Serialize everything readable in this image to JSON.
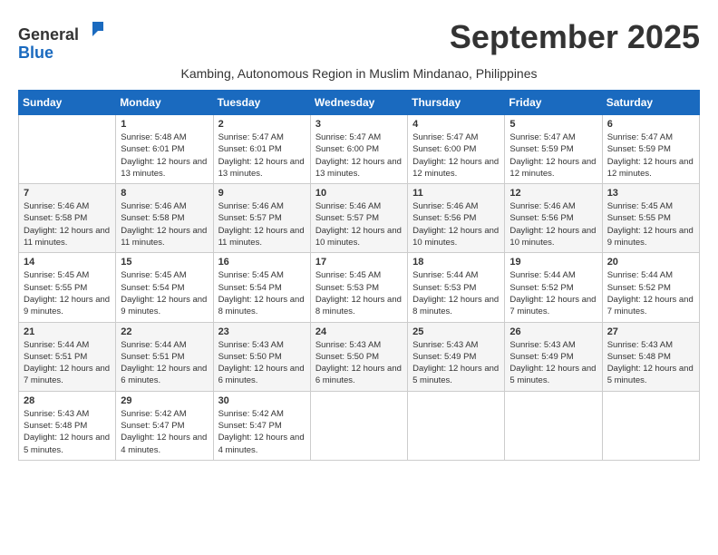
{
  "header": {
    "logo_general": "General",
    "logo_blue": "Blue",
    "month_year": "September 2025",
    "subtitle": "Kambing, Autonomous Region in Muslim Mindanao, Philippines"
  },
  "days_of_week": [
    "Sunday",
    "Monday",
    "Tuesday",
    "Wednesday",
    "Thursday",
    "Friday",
    "Saturday"
  ],
  "weeks": [
    [
      {
        "day": "",
        "sunrise": "",
        "sunset": "",
        "daylight": ""
      },
      {
        "day": "1",
        "sunrise": "Sunrise: 5:48 AM",
        "sunset": "Sunset: 6:01 PM",
        "daylight": "Daylight: 12 hours and 13 minutes."
      },
      {
        "day": "2",
        "sunrise": "Sunrise: 5:47 AM",
        "sunset": "Sunset: 6:01 PM",
        "daylight": "Daylight: 12 hours and 13 minutes."
      },
      {
        "day": "3",
        "sunrise": "Sunrise: 5:47 AM",
        "sunset": "Sunset: 6:00 PM",
        "daylight": "Daylight: 12 hours and 13 minutes."
      },
      {
        "day": "4",
        "sunrise": "Sunrise: 5:47 AM",
        "sunset": "Sunset: 6:00 PM",
        "daylight": "Daylight: 12 hours and 12 minutes."
      },
      {
        "day": "5",
        "sunrise": "Sunrise: 5:47 AM",
        "sunset": "Sunset: 5:59 PM",
        "daylight": "Daylight: 12 hours and 12 minutes."
      },
      {
        "day": "6",
        "sunrise": "Sunrise: 5:47 AM",
        "sunset": "Sunset: 5:59 PM",
        "daylight": "Daylight: 12 hours and 12 minutes."
      }
    ],
    [
      {
        "day": "7",
        "sunrise": "Sunrise: 5:46 AM",
        "sunset": "Sunset: 5:58 PM",
        "daylight": "Daylight: 12 hours and 11 minutes."
      },
      {
        "day": "8",
        "sunrise": "Sunrise: 5:46 AM",
        "sunset": "Sunset: 5:58 PM",
        "daylight": "Daylight: 12 hours and 11 minutes."
      },
      {
        "day": "9",
        "sunrise": "Sunrise: 5:46 AM",
        "sunset": "Sunset: 5:57 PM",
        "daylight": "Daylight: 12 hours and 11 minutes."
      },
      {
        "day": "10",
        "sunrise": "Sunrise: 5:46 AM",
        "sunset": "Sunset: 5:57 PM",
        "daylight": "Daylight: 12 hours and 10 minutes."
      },
      {
        "day": "11",
        "sunrise": "Sunrise: 5:46 AM",
        "sunset": "Sunset: 5:56 PM",
        "daylight": "Daylight: 12 hours and 10 minutes."
      },
      {
        "day": "12",
        "sunrise": "Sunrise: 5:46 AM",
        "sunset": "Sunset: 5:56 PM",
        "daylight": "Daylight: 12 hours and 10 minutes."
      },
      {
        "day": "13",
        "sunrise": "Sunrise: 5:45 AM",
        "sunset": "Sunset: 5:55 PM",
        "daylight": "Daylight: 12 hours and 9 minutes."
      }
    ],
    [
      {
        "day": "14",
        "sunrise": "Sunrise: 5:45 AM",
        "sunset": "Sunset: 5:55 PM",
        "daylight": "Daylight: 12 hours and 9 minutes."
      },
      {
        "day": "15",
        "sunrise": "Sunrise: 5:45 AM",
        "sunset": "Sunset: 5:54 PM",
        "daylight": "Daylight: 12 hours and 9 minutes."
      },
      {
        "day": "16",
        "sunrise": "Sunrise: 5:45 AM",
        "sunset": "Sunset: 5:54 PM",
        "daylight": "Daylight: 12 hours and 8 minutes."
      },
      {
        "day": "17",
        "sunrise": "Sunrise: 5:45 AM",
        "sunset": "Sunset: 5:53 PM",
        "daylight": "Daylight: 12 hours and 8 minutes."
      },
      {
        "day": "18",
        "sunrise": "Sunrise: 5:44 AM",
        "sunset": "Sunset: 5:53 PM",
        "daylight": "Daylight: 12 hours and 8 minutes."
      },
      {
        "day": "19",
        "sunrise": "Sunrise: 5:44 AM",
        "sunset": "Sunset: 5:52 PM",
        "daylight": "Daylight: 12 hours and 7 minutes."
      },
      {
        "day": "20",
        "sunrise": "Sunrise: 5:44 AM",
        "sunset": "Sunset: 5:52 PM",
        "daylight": "Daylight: 12 hours and 7 minutes."
      }
    ],
    [
      {
        "day": "21",
        "sunrise": "Sunrise: 5:44 AM",
        "sunset": "Sunset: 5:51 PM",
        "daylight": "Daylight: 12 hours and 7 minutes."
      },
      {
        "day": "22",
        "sunrise": "Sunrise: 5:44 AM",
        "sunset": "Sunset: 5:51 PM",
        "daylight": "Daylight: 12 hours and 6 minutes."
      },
      {
        "day": "23",
        "sunrise": "Sunrise: 5:43 AM",
        "sunset": "Sunset: 5:50 PM",
        "daylight": "Daylight: 12 hours and 6 minutes."
      },
      {
        "day": "24",
        "sunrise": "Sunrise: 5:43 AM",
        "sunset": "Sunset: 5:50 PM",
        "daylight": "Daylight: 12 hours and 6 minutes."
      },
      {
        "day": "25",
        "sunrise": "Sunrise: 5:43 AM",
        "sunset": "Sunset: 5:49 PM",
        "daylight": "Daylight: 12 hours and 5 minutes."
      },
      {
        "day": "26",
        "sunrise": "Sunrise: 5:43 AM",
        "sunset": "Sunset: 5:49 PM",
        "daylight": "Daylight: 12 hours and 5 minutes."
      },
      {
        "day": "27",
        "sunrise": "Sunrise: 5:43 AM",
        "sunset": "Sunset: 5:48 PM",
        "daylight": "Daylight: 12 hours and 5 minutes."
      }
    ],
    [
      {
        "day": "28",
        "sunrise": "Sunrise: 5:43 AM",
        "sunset": "Sunset: 5:48 PM",
        "daylight": "Daylight: 12 hours and 5 minutes."
      },
      {
        "day": "29",
        "sunrise": "Sunrise: 5:42 AM",
        "sunset": "Sunset: 5:47 PM",
        "daylight": "Daylight: 12 hours and 4 minutes."
      },
      {
        "day": "30",
        "sunrise": "Sunrise: 5:42 AM",
        "sunset": "Sunset: 5:47 PM",
        "daylight": "Daylight: 12 hours and 4 minutes."
      },
      {
        "day": "",
        "sunrise": "",
        "sunset": "",
        "daylight": ""
      },
      {
        "day": "",
        "sunrise": "",
        "sunset": "",
        "daylight": ""
      },
      {
        "day": "",
        "sunrise": "",
        "sunset": "",
        "daylight": ""
      },
      {
        "day": "",
        "sunrise": "",
        "sunset": "",
        "daylight": ""
      }
    ]
  ]
}
